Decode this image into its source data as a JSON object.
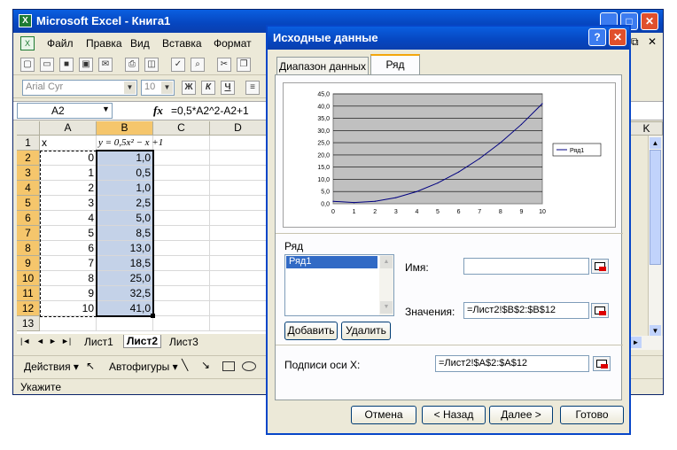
{
  "excel": {
    "title": "Microsoft Excel - Книга1",
    "menu": [
      "Файл",
      "Правка",
      "Вид",
      "Вставка",
      "Формат"
    ],
    "font_name": "Arial Cyr",
    "font_size": "10",
    "fmt_buttons": [
      "Ж",
      "К",
      "Ч"
    ],
    "name_box": "A2",
    "fx": "fx",
    "formula": "=0,5*A2^2-A2+1",
    "columns": [
      "A",
      "B",
      "C",
      "D"
    ],
    "rows": [
      {
        "n": "1",
        "a": "x",
        "b": "y = 0,5x² − x +1"
      },
      {
        "n": "2",
        "a": "0",
        "b": "1,0"
      },
      {
        "n": "3",
        "a": "1",
        "b": "0,5"
      },
      {
        "n": "4",
        "a": "2",
        "b": "1,0"
      },
      {
        "n": "5",
        "a": "3",
        "b": "2,5"
      },
      {
        "n": "6",
        "a": "4",
        "b": "5,0"
      },
      {
        "n": "7",
        "a": "5",
        "b": "8,5"
      },
      {
        "n": "8",
        "a": "6",
        "b": "13,0"
      },
      {
        "n": "9",
        "a": "7",
        "b": "18,5"
      },
      {
        "n": "10",
        "a": "8",
        "b": "25,0"
      },
      {
        "n": "11",
        "a": "9",
        "b": "32,5"
      },
      {
        "n": "12",
        "a": "10",
        "b": "41,0"
      },
      {
        "n": "13",
        "a": "",
        "b": ""
      }
    ],
    "col_k": "K",
    "sheets": [
      "Лист1",
      "Лист2",
      "Лист3"
    ],
    "draw_actions": "Действия",
    "autoshapes": "Автофигуры",
    "status": "Укажите"
  },
  "dialog": {
    "title": "Исходные данные",
    "tabs": [
      "Диапазон данных",
      "Ряд"
    ],
    "active_tab": "Ряд",
    "series_label": "Ряд",
    "series_list": [
      "Ряд1"
    ],
    "add_btn": "Добавить",
    "remove_btn": "Удалить",
    "name_label": "Имя:",
    "name_value": "",
    "values_label": "Значения:",
    "values_value": "=Лист2!$B$2:$B$12",
    "xlabels_label": "Подписи оси X:",
    "xlabels_value": "=Лист2!$A$2:$A$12",
    "buttons": {
      "cancel": "Отмена",
      "back": "< Назад",
      "next": "Далее >",
      "finish": "Готово"
    }
  },
  "chart_data": {
    "type": "line",
    "categories": [
      "0",
      "1",
      "2",
      "3",
      "4",
      "5",
      "6",
      "7",
      "8",
      "9",
      "10"
    ],
    "series": [
      {
        "name": "Ряд1",
        "values": [
          1.0,
          0.5,
          1.0,
          2.5,
          5.0,
          8.5,
          13.0,
          18.5,
          25.0,
          32.5,
          41.0
        ]
      }
    ],
    "y_ticks": [
      "0,0",
      "5,0",
      "10,0",
      "15,0",
      "20,0",
      "25,0",
      "30,0",
      "35,0",
      "40,0",
      "45,0"
    ],
    "ylim": [
      0,
      45
    ],
    "grid": true,
    "legend": "right",
    "colors": {
      "line": "#000080",
      "plot_bg": "#c0c0c0"
    }
  }
}
